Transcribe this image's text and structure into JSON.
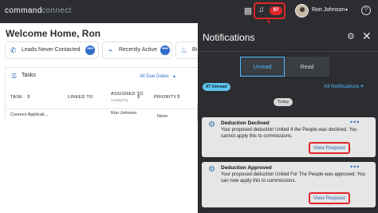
{
  "topbar": {
    "brand_main": "command",
    "brand_sub": "connect",
    "notification_count": "97",
    "user_name": "Ron Johnson",
    "help_symbol": "?"
  },
  "dashboard": {
    "welcome": "Welcome Home, Ron",
    "stats": [
      {
        "label": "Leads Never Contacted",
        "icon": "phone-icon"
      },
      {
        "label": "Recently Active",
        "icon": "activity-icon"
      },
      {
        "label": "Bi",
        "icon": "cake-icon"
      }
    ],
    "tasks": {
      "title": "Tasks",
      "filter": "All Due Dates",
      "columns": [
        "TASK",
        "LINKED TO",
        "ASSIGNED TO",
        "PRIORITY"
      ],
      "assigned_sub": "Created by",
      "row": {
        "task": "Connect Applicati...",
        "assigned": "Ron Johnson",
        "priority": "None"
      }
    }
  },
  "notifications": {
    "title": "Notifications",
    "tabs": {
      "unread": "Unread",
      "read": "Read"
    },
    "unread_count": "97 Unread",
    "filter": "All Notifications",
    "date_group": "Today",
    "items": [
      {
        "title": "Deduction Declined",
        "body": "Your proposed deduction United 4 the People was declined. You cannot apply this to commissions.",
        "action": "View Request"
      },
      {
        "title": "Deduction Approved",
        "body": "Your proposed deduction United For The People was approved. You can now apply this to commissions.",
        "action": "View Request"
      }
    ]
  },
  "colors": {
    "topbar_bg": "#2b2d30",
    "accent_blue": "#4db8ff",
    "highlight_red": "#e0262c",
    "card_bg": "#e6e6e6"
  }
}
